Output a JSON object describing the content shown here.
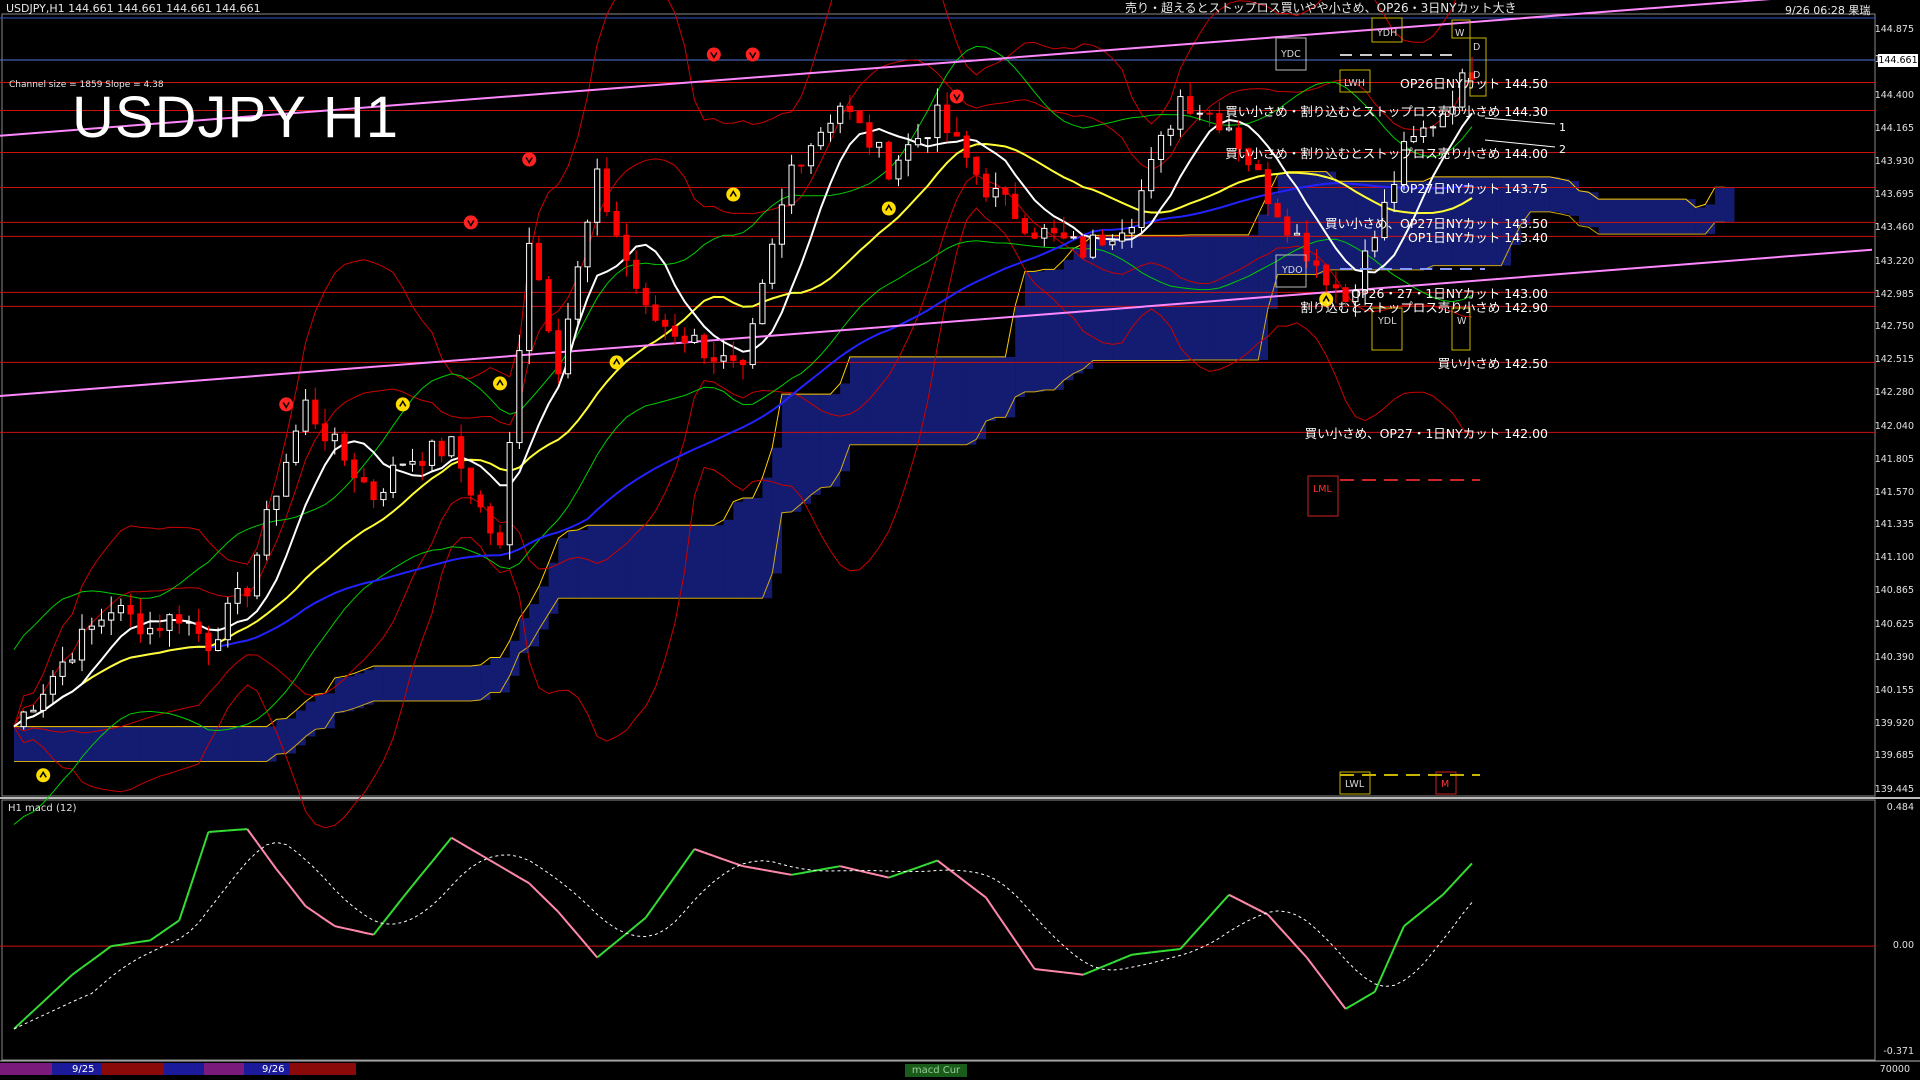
{
  "header": {
    "symbol_line": "USDJPY,H1  144.661 144.661 144.661 144.661",
    "top_message": "売り・超えるとストップロス買いやや小さめ、OP26・3日NYカット大き",
    "datetime": "9/26 06:28 果瑞",
    "channel_info": "Channel size = 1859 Slope = 4.38",
    "big_title": "USDJPY H1"
  },
  "price_axis": {
    "ticks": [
      "144.875",
      "144.661",
      "144.400",
      "144.165",
      "143.930",
      "143.695",
      "143.460",
      "143.220",
      "142.985",
      "142.750",
      "142.515",
      "142.280",
      "142.040",
      "141.805",
      "141.570",
      "141.335",
      "141.100",
      "140.865",
      "140.625",
      "140.390",
      "140.155",
      "139.920",
      "139.685",
      "139.445"
    ],
    "current": "144.661"
  },
  "macd_axis": {
    "ticks": [
      "0.484",
      "0.00",
      "-0.371"
    ]
  },
  "levels": [
    {
      "price": 144.5,
      "text": "OP26日NYカット 144.50"
    },
    {
      "price": 144.3,
      "text": "買い小さめ・割り込むとストップロス売り小さめ 144.30"
    },
    {
      "price": 144.0,
      "text": "買い小さめ・割り込むとストップロス売り小さめ 144.00"
    },
    {
      "price": 143.75,
      "text": "OP27日NYカット 143.75"
    },
    {
      "price": 143.5,
      "text": "買い小さめ、OP27日NYカット 143.50"
    },
    {
      "price": 143.4,
      "text": "OP1日NYカット 143.40"
    },
    {
      "price": 143.0,
      "text": "OP26・27・1日NYカット 143.00"
    },
    {
      "price": 142.9,
      "text": "割り込むとストップロス売り小さめ 142.90"
    },
    {
      "price": 142.5,
      "text": "買い小さめ 142.50"
    },
    {
      "price": 142.0,
      "text": "買い小さめ、OP27・1日NYカット 142.00"
    }
  ],
  "box_labels": {
    "ydh": "YDH",
    "lwh": "LWH",
    "ydc": "YDC",
    "ydo": "YDO",
    "ydl": "YDL",
    "lml": "LML",
    "lwl": "LWL",
    "w": "W",
    "d": "D",
    "m": "M",
    "one": "1",
    "two": "2"
  },
  "sub_window": {
    "title": "H1  macd (12)"
  },
  "bottom": {
    "date1": "9/25",
    "date2": "9/26",
    "macd_tag": "macd Cur",
    "right": "70000"
  },
  "colors": {
    "background": "#000000",
    "bull": "#ffffff",
    "bear": "#ff0000",
    "ma_fast": "#ffffff",
    "ma_mid": "#ffff33",
    "ma_slow": "#2222ff",
    "channel": "#ff88ff",
    "level_line": "#cc1111",
    "bb": "#cc0000",
    "env": "#00cc00",
    "cloud_red": "#cc3322",
    "cloud_blue": "#2233cc",
    "cloud_edge": "#ffcc00",
    "macd_up": "#33dd33",
    "macd_down": "#ff88aa",
    "signal": "#ffffff"
  },
  "chart_data": {
    "type": "candlestick",
    "symbol": "USDJPY",
    "timeframe": "H1",
    "ylim": [
      139.445,
      144.875
    ],
    "macd_ylim": [
      -0.371,
      0.484
    ],
    "anchors_x": [
      0,
      6,
      10,
      14,
      17,
      20,
      24,
      27,
      30,
      33,
      37,
      40,
      45,
      50,
      53,
      56,
      60,
      65,
      70,
      75,
      80,
      85,
      90,
      95,
      100,
      105,
      110,
      115,
      120,
      125,
      129,
      133,
      137,
      140,
      143,
      147,
      150
    ],
    "close_anchors": [
      139.9,
      140.45,
      140.75,
      140.6,
      140.7,
      140.5,
      140.9,
      141.6,
      142.2,
      141.9,
      141.55,
      141.8,
      141.9,
      141.15,
      143.4,
      142.5,
      143.8,
      142.85,
      142.65,
      142.4,
      143.9,
      144.35,
      143.9,
      144.25,
      143.75,
      143.45,
      143.3,
      143.55,
      144.4,
      144.2,
      143.7,
      143.3,
      142.95,
      143.4,
      144.0,
      144.3,
      144.6
    ],
    "macd_anchors": [
      -0.29,
      -0.1,
      0.0,
      0.02,
      0.09,
      0.4,
      0.41,
      0.27,
      0.14,
      0.07,
      0.04,
      0.17,
      0.38,
      0.28,
      0.22,
      0.12,
      -0.04,
      0.1,
      0.34,
      0.28,
      0.25,
      0.28,
      0.24,
      0.3,
      0.17,
      -0.08,
      -0.1,
      -0.03,
      -0.01,
      0.18,
      0.11,
      -0.04,
      -0.22,
      -0.16,
      0.07,
      0.18,
      0.29
    ],
    "channel_upper": [
      [
        0,
        144.12
      ],
      [
        150,
        144.93
      ]
    ],
    "channel_lower": [
      [
        0,
        142.26
      ],
      [
        150,
        143.08
      ]
    ]
  }
}
